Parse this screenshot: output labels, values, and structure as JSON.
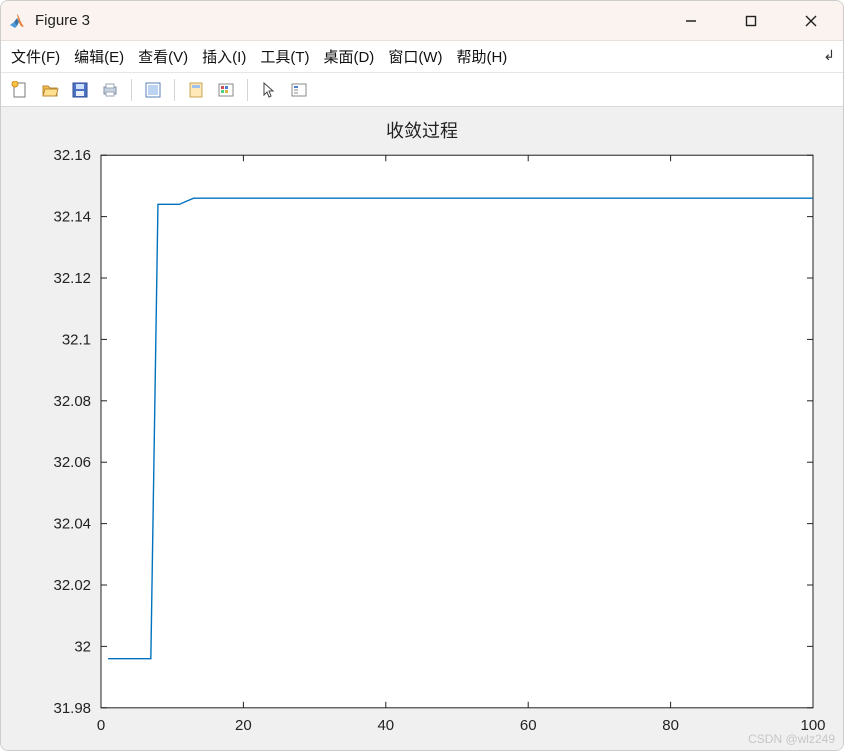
{
  "window": {
    "title": "Figure 3"
  },
  "menu": {
    "file": "文件(F)",
    "edit": "编辑(E)",
    "view": "查看(V)",
    "insert": "插入(I)",
    "tools": "工具(T)",
    "desktop": "桌面(D)",
    "window": "窗口(W)",
    "help": "帮助(H)"
  },
  "toolbar_icons": {
    "new": "new-figure-icon",
    "open": "open-icon",
    "save": "save-icon",
    "print": "print-icon",
    "zoom": "edit-plot-icon",
    "link": "link-icon",
    "colorbar": "colorbar-icon",
    "cursor": "cursor-icon",
    "insert": "insert-legend-icon"
  },
  "watermark": "CSDN @wlz249",
  "chart_data": {
    "type": "line",
    "title": "收敛过程",
    "xlabel": "",
    "ylabel": "",
    "xlim": [
      0,
      100
    ],
    "ylim": [
      31.98,
      32.16
    ],
    "xticks": [
      0,
      20,
      40,
      60,
      80,
      100
    ],
    "yticks": [
      31.98,
      32,
      32.02,
      32.04,
      32.06,
      32.08,
      32.1,
      32.12,
      32.14,
      32.16
    ],
    "ytick_labels": [
      "31.98",
      "32",
      "32.02",
      "32.04",
      "32.06",
      "32.08",
      "32.1",
      "32.12",
      "32.14",
      "32.16"
    ],
    "series": [
      {
        "name": "convergence",
        "color": "#0072BD",
        "x": [
          1,
          2,
          3,
          4,
          5,
          6,
          7,
          8,
          9,
          10,
          11,
          12,
          13,
          14,
          15,
          20,
          30,
          40,
          50,
          60,
          70,
          80,
          90,
          100
        ],
        "y": [
          31.996,
          31.996,
          31.996,
          31.996,
          31.996,
          31.996,
          31.996,
          32.144,
          32.144,
          32.144,
          32.144,
          32.145,
          32.146,
          32.146,
          32.146,
          32.146,
          32.146,
          32.146,
          32.146,
          32.146,
          32.146,
          32.146,
          32.146,
          32.146
        ]
      }
    ]
  }
}
